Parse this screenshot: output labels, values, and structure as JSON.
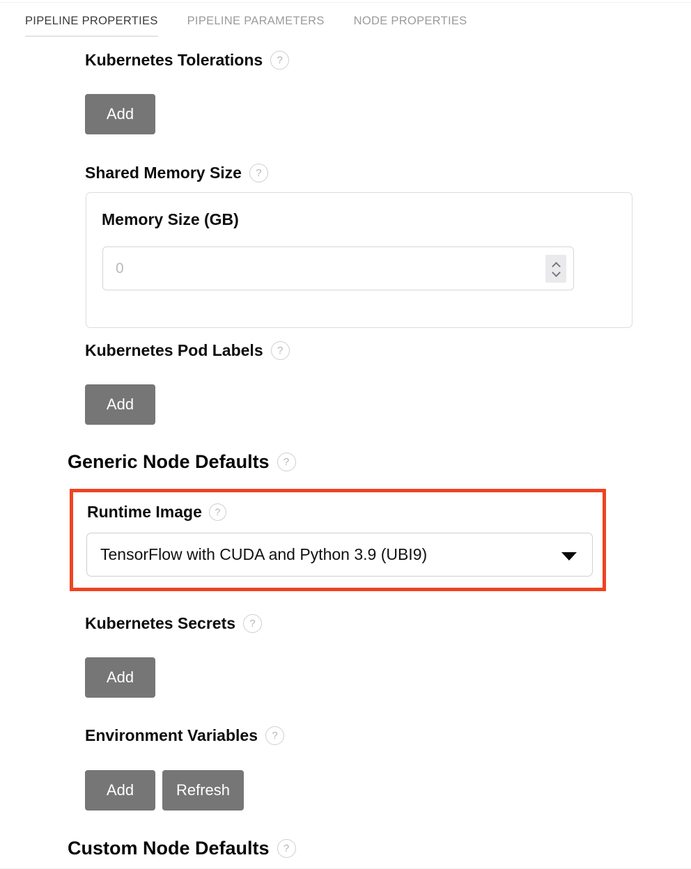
{
  "tabs": [
    {
      "label": "PIPELINE PROPERTIES",
      "active": true
    },
    {
      "label": "PIPELINE PARAMETERS",
      "active": false
    },
    {
      "label": "NODE PROPERTIES",
      "active": false
    }
  ],
  "icons": {
    "help": "?",
    "chevron_up": "chevron-up-icon",
    "chevron_down": "chevron-down-icon",
    "caret_down": "caret-down-icon"
  },
  "colors": {
    "highlight": "#ee4323",
    "button": "#767676",
    "active_tab_text": "#3b3b3b",
    "inactive_tab_text": "#9b9b9b",
    "spinner_bg": "#eaeaec"
  },
  "fields": {
    "tolerations": {
      "label": "Kubernetes Tolerations",
      "add_label": "Add"
    },
    "shared_memory": {
      "label": "Shared Memory Size",
      "inner_label": "Memory Size (GB)",
      "value": "",
      "placeholder": "0"
    },
    "pod_labels": {
      "label": "Kubernetes Pod Labels",
      "add_label": "Add"
    },
    "generic_node_defaults": {
      "heading": "Generic Node Defaults"
    },
    "runtime_image": {
      "label": "Runtime Image",
      "selected": "TensorFlow with CUDA and Python 3.9 (UBI9)",
      "highlighted": true
    },
    "secrets": {
      "label": "Kubernetes Secrets",
      "add_label": "Add"
    },
    "env_vars": {
      "label": "Environment Variables",
      "add_label": "Add",
      "refresh_label": "Refresh"
    },
    "custom_node_defaults": {
      "heading": "Custom Node Defaults"
    }
  }
}
